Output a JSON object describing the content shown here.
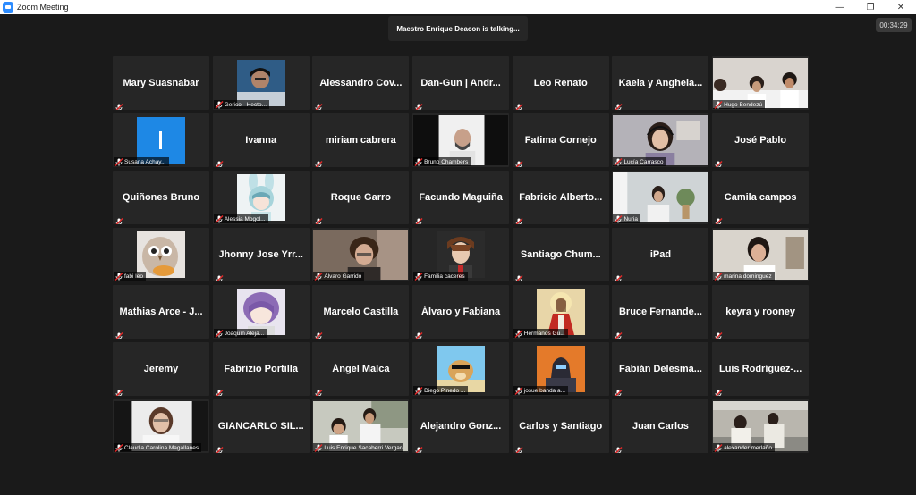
{
  "window": {
    "title": "Zoom Meeting",
    "controls": [
      "—",
      "❐",
      "✕"
    ]
  },
  "speaker_banner": "Maestro Enrique Deacon is talking...",
  "timer": "00:34:29",
  "colors": {
    "tile_bg": "#262626",
    "stage_bg": "#1a1a1a",
    "muted_red": "#e02828"
  },
  "participants": [
    {
      "name": "Mary Suasnabar",
      "kind": "name"
    },
    {
      "name": "Gerico - Hecto...",
      "kind": "avatar",
      "pic": "boy"
    },
    {
      "name": "Alessandro  Cov...",
      "kind": "name"
    },
    {
      "name": "Dan-Gun | Andr...",
      "kind": "name"
    },
    {
      "name": "Leo Renato",
      "kind": "name"
    },
    {
      "name": "Kaela  y  Anghela...",
      "kind": "name"
    },
    {
      "name": "Hugo Bendezú",
      "kind": "video",
      "pic": "room3"
    },
    {
      "name": "Susana Achay...",
      "kind": "avatar",
      "pic": "blue"
    },
    {
      "name": "Ivanna",
      "kind": "name"
    },
    {
      "name": "miriam cabrera",
      "kind": "name"
    },
    {
      "name": "Bruno Chambers",
      "kind": "video",
      "pic": "man"
    },
    {
      "name": "Fatima Cornejo",
      "kind": "name"
    },
    {
      "name": "Lucía Carrasco",
      "kind": "video",
      "pic": "girl"
    },
    {
      "name": "José Pablo",
      "kind": "name"
    },
    {
      "name": "Quiñones Bruno",
      "kind": "name"
    },
    {
      "name": "Alessia Mogol...",
      "kind": "avatar",
      "pic": "anime"
    },
    {
      "name": "Roque Garro",
      "kind": "name"
    },
    {
      "name": "Facundo Maguiña",
      "kind": "name"
    },
    {
      "name": "Fabricio  Alberto...",
      "kind": "name"
    },
    {
      "name": "Nuria",
      "kind": "video",
      "pic": "room2"
    },
    {
      "name": "Camila campos",
      "kind": "name"
    },
    {
      "name": "fabi leo",
      "kind": "avatar",
      "pic": "owl"
    },
    {
      "name": "Jhonny Jose Yrr...",
      "kind": "name"
    },
    {
      "name": "Alvaro Garrido",
      "kind": "video",
      "pic": "curly"
    },
    {
      "name": "Familia caceres",
      "kind": "avatar",
      "pic": "anime2"
    },
    {
      "name": "Santiago  Chum...",
      "kind": "name"
    },
    {
      "name": "iPad",
      "kind": "name"
    },
    {
      "name": "marina dominguez",
      "kind": "video",
      "pic": "girl2"
    },
    {
      "name": "Mathias  Arce  -  J...",
      "kind": "name"
    },
    {
      "name": "Joaquín Aleja...",
      "kind": "avatar",
      "pic": "anime3"
    },
    {
      "name": "Marcelo Castilla",
      "kind": "name"
    },
    {
      "name": "Álvaro y Fabiana",
      "kind": "name"
    },
    {
      "name": "Hermanos Gu...",
      "kind": "avatar",
      "pic": "jesus"
    },
    {
      "name": "Bruce  Fernande...",
      "kind": "name"
    },
    {
      "name": "keyra y rooney",
      "kind": "name"
    },
    {
      "name": "Jeremy",
      "kind": "name"
    },
    {
      "name": "Fabrizio Portilla",
      "kind": "name"
    },
    {
      "name": "Ángel Malca",
      "kind": "name"
    },
    {
      "name": "Diego Pinedo ...",
      "kind": "avatar",
      "pic": "doge"
    },
    {
      "name": "josue banda a...",
      "kind": "avatar",
      "pic": "fort"
    },
    {
      "name": "Fabián  Delesma...",
      "kind": "name"
    },
    {
      "name": "Luis  Rodríguez-...",
      "kind": "name"
    },
    {
      "name": "Claudia Carolina Magallanes",
      "kind": "video",
      "pic": "woman"
    },
    {
      "name": "GIANCARLO  SIL...",
      "kind": "name"
    },
    {
      "name": "Luis Enrique Sacaberri Vergara",
      "kind": "video",
      "pic": "kids"
    },
    {
      "name": "Alejandro  Gonz...",
      "kind": "name"
    },
    {
      "name": "Carlos y Santiago",
      "kind": "name"
    },
    {
      "name": "Juan Carlos",
      "kind": "name"
    },
    {
      "name": "alexander merlaño",
      "kind": "video",
      "pic": "room4"
    }
  ]
}
